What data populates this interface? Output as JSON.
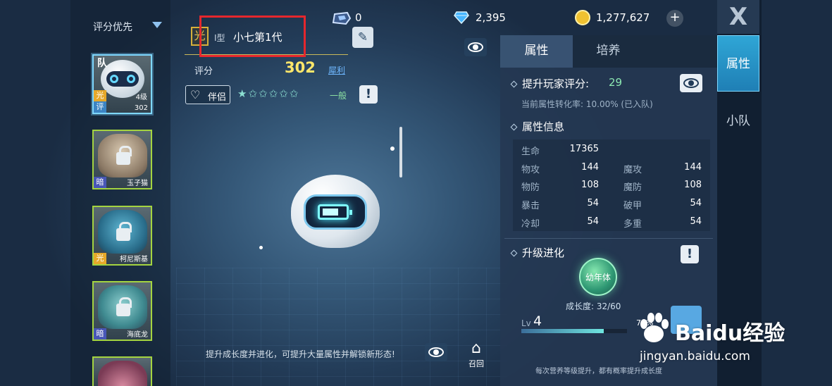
{
  "sidebar": {
    "sort_label": "评分优先",
    "cards": [
      {
        "team_badge": "队",
        "element": "光",
        "level": "4级",
        "rating_tag": "评",
        "score": "302",
        "locked": false
      },
      {
        "element": "暗",
        "name": "玉子猫",
        "locked": true
      },
      {
        "element": "光",
        "name": "柯尼斯基",
        "locked": true
      },
      {
        "element": "暗",
        "name": "海底龙",
        "locked": true
      }
    ]
  },
  "hud": {
    "gems_small": "0",
    "diamonds": "2,395",
    "coins": "1,277,627",
    "plus": "+"
  },
  "pet": {
    "element_tag": "光",
    "type_label": "I型",
    "name": "小七第1代",
    "score_label": "评分",
    "score_value": "302",
    "score_tag": "犀利",
    "partner_label": "伴侣",
    "stars": "★✩✩✩✩✩",
    "quality": "一般",
    "hint": "提升成长度并进化，可提升大量属性并解锁新形态!",
    "recall": "召回"
  },
  "panel": {
    "tabs": [
      "属性",
      "培养"
    ],
    "boost_title": "提升玩家评分:",
    "boost_value": "29",
    "conversion": "当前属性转化率: 10.00% (已入队)",
    "attr_title": "属性信息",
    "attrs": [
      {
        "label": "生命",
        "value": "17365"
      },
      {
        "label": "物攻",
        "value": "144"
      },
      {
        "label": "魔攻",
        "value": "144"
      },
      {
        "label": "物防",
        "value": "108"
      },
      {
        "label": "魔防",
        "value": "108"
      },
      {
        "label": "暴击",
        "value": "54"
      },
      {
        "label": "破甲",
        "value": "54"
      },
      {
        "label": "冷却",
        "value": "54"
      },
      {
        "label": "多重",
        "value": "54"
      }
    ],
    "evolve_title": "升级进化",
    "stage": "幼年体",
    "growth": "成长度: 32/60",
    "lv_label": "Lv",
    "lv_value": "4",
    "xp_percent": "78%",
    "xp_fraction": 0.78,
    "note": "每次营养等级提升，都有概率提升成长度"
  },
  "side": {
    "close": "X",
    "tabs": [
      "属性",
      "小队"
    ]
  },
  "watermark": {
    "brand": "Baidu经验",
    "url": "jingyan.baidu.com"
  },
  "colors": {
    "accent": "#2fa6d6",
    "highlight_box": "#e5272d",
    "score": "#ffe76a",
    "green": "#8ce8b2"
  }
}
